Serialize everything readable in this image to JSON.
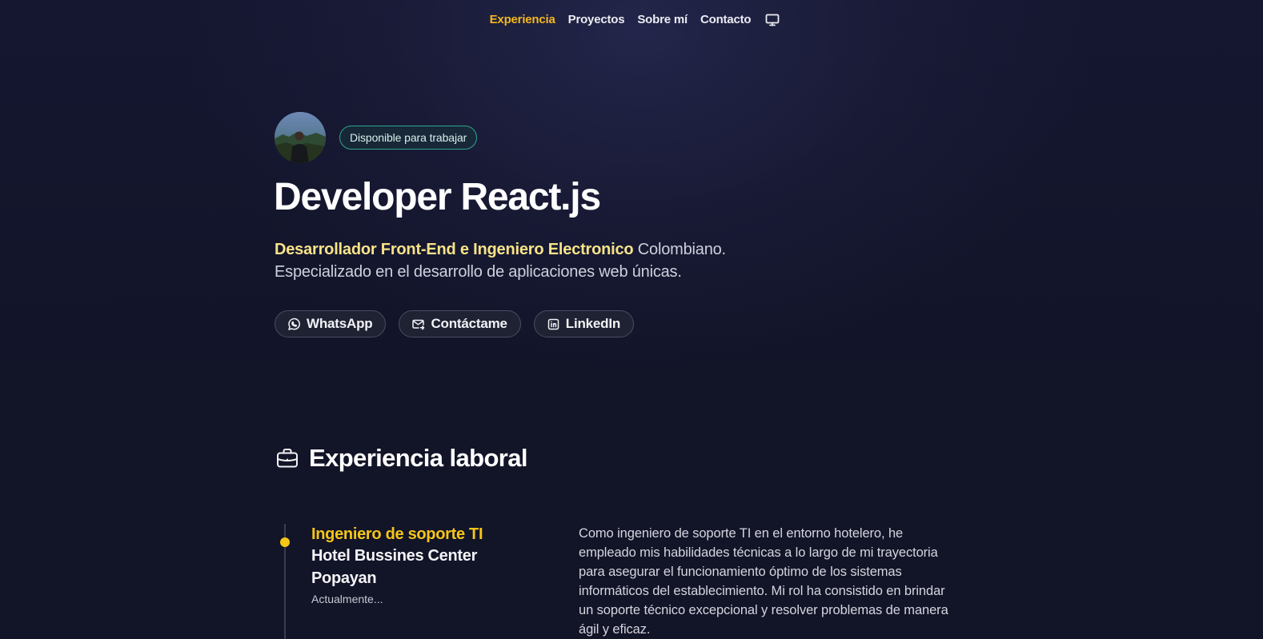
{
  "nav": {
    "items": [
      {
        "label": "Experiencia",
        "active": true
      },
      {
        "label": "Proyectos",
        "active": false
      },
      {
        "label": "Sobre mí",
        "active": false
      },
      {
        "label": "Contacto",
        "active": false
      }
    ],
    "theme_icon": "monitor-icon",
    "active_color": "#f5b81c"
  },
  "hero": {
    "badge": "Disponible para trabajar",
    "title": "Developer React.js",
    "desc_highlight": "Desarrollador Front-End e Ingeniero Electronico",
    "desc_rest_line1": " Colombiano.",
    "desc_line2": "Especializado en el desarrollo de aplicaciones web únicas.",
    "highlight_color": "#f8e388",
    "buttons": [
      {
        "label": "WhatsApp",
        "icon": "whatsapp-icon"
      },
      {
        "label": "Contáctame",
        "icon": "mail-icon"
      },
      {
        "label": "LinkedIn",
        "icon": "linkedin-icon"
      }
    ]
  },
  "experience": {
    "heading": "Experiencia laboral",
    "heading_icon": "briefcase-icon",
    "jobs": [
      {
        "role": "Ingeniero de soporte TI",
        "company": "Hotel Bussines Center Popayan",
        "date": "Actualmente...",
        "description": "Como ingeniero de soporte TI en el entorno hotelero, he empleado mis habilidades técnicas a lo largo de mi trayectoria para asegurar el funcionamiento óptimo de los sistemas informáticos del establecimiento. Mi rol ha consistido en brindar un soporte técnico excepcional y resolver problemas de manera ágil y eficaz."
      }
    ],
    "accent_color": "#f5c518"
  }
}
